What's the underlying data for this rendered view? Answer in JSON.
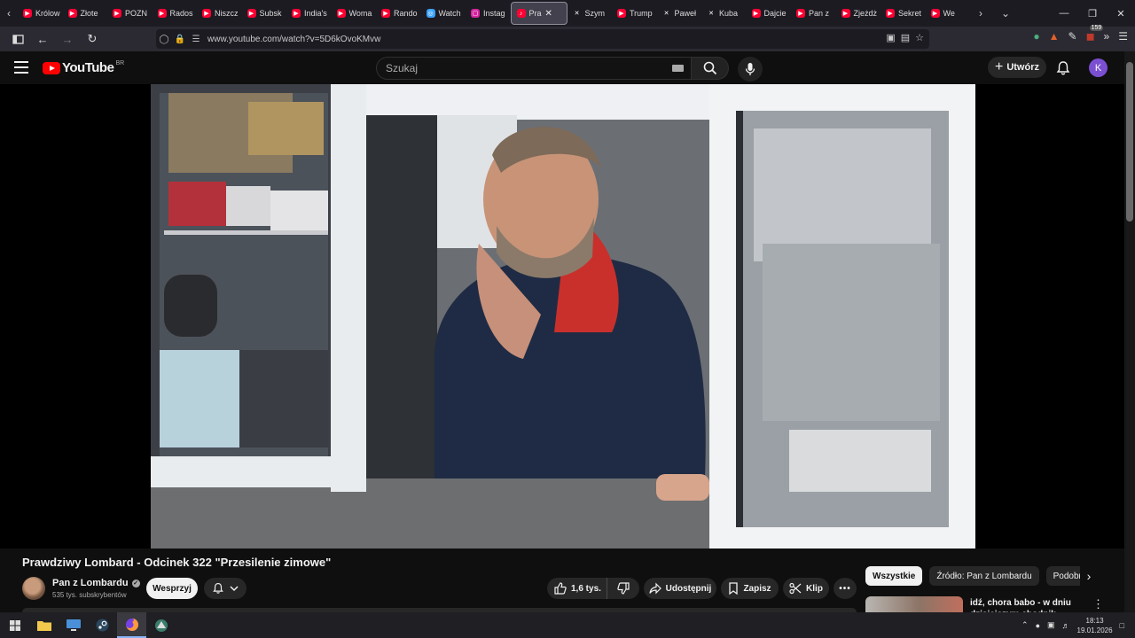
{
  "browser": {
    "tabs": [
      {
        "label": "Królow",
        "favicon": "youtube",
        "color": "#ff0033"
      },
      {
        "label": "Złote",
        "favicon": "youtube",
        "color": "#ff0033"
      },
      {
        "label": "POZN",
        "favicon": "youtube",
        "color": "#ff0033"
      },
      {
        "label": "Rados",
        "favicon": "youtube",
        "color": "#ff0033"
      },
      {
        "label": "Niszcz",
        "favicon": "youtube",
        "color": "#ff0033"
      },
      {
        "label": "Subsk",
        "favicon": "youtube",
        "color": "#ff0033"
      },
      {
        "label": "India's",
        "favicon": "youtube",
        "color": "#ff0033"
      },
      {
        "label": "Woma",
        "favicon": "youtube",
        "color": "#ff0033"
      },
      {
        "label": "Rando",
        "favicon": "youtube",
        "color": "#ff0033"
      },
      {
        "label": "Watch",
        "favicon": "watch",
        "color": "#3aa3ff"
      },
      {
        "label": "Instag",
        "favicon": "instagram",
        "color": "#d6249f"
      },
      {
        "label": "Pra",
        "favicon": "speaker",
        "color": "#ff0033",
        "active": true
      },
      {
        "label": "Szym",
        "favicon": "x",
        "color": "#1c1b22"
      },
      {
        "label": "Trump",
        "favicon": "youtube",
        "color": "#ff0033"
      },
      {
        "label": "Paweł",
        "favicon": "x",
        "color": "#1c1b22"
      },
      {
        "label": "Kuba",
        "favicon": "x",
        "color": "#1c1b22"
      },
      {
        "label": "Dajcie",
        "favicon": "youtube",
        "color": "#ff0033"
      },
      {
        "label": "Pan z",
        "favicon": "youtube",
        "color": "#ff0033"
      },
      {
        "label": "Zjeżdż",
        "favicon": "youtube",
        "color": "#ff0033"
      },
      {
        "label": "Sekret",
        "favicon": "youtube",
        "color": "#ff0033"
      },
      {
        "label": "We",
        "favicon": "youtube",
        "color": "#ff0033"
      }
    ],
    "url": "www.youtube.com/watch?v=5D6kOvoKMvw",
    "notification_count": "159"
  },
  "youtube": {
    "logo_text": "YouTube",
    "country_code": "BR",
    "search_placeholder": "Szukaj",
    "create_label": "Utwórz",
    "avatar_letter": "K"
  },
  "video": {
    "title": "Prawdziwy Lombard - Odcinek 322 \"Przesilenie zimowe\"",
    "channel_name": "Pan z Lombardu",
    "subscribers": "535 tys. subskrybentów",
    "join_label": "Wesprzyj",
    "likes": "1,6 tys.",
    "share_label": "Udostępnij",
    "save_label": "Zapisz",
    "clip_label": "Klip"
  },
  "sidebar": {
    "chips": [
      "Wszystkie",
      "Źródło: Pan z Lombardu",
      "Podobne"
    ],
    "recommendation_title": "idź, chora babo - w dniu dzisiejszym chodnik nieczynny"
  },
  "taskbar": {
    "time": "18:13",
    "date": "19.01.2026"
  }
}
